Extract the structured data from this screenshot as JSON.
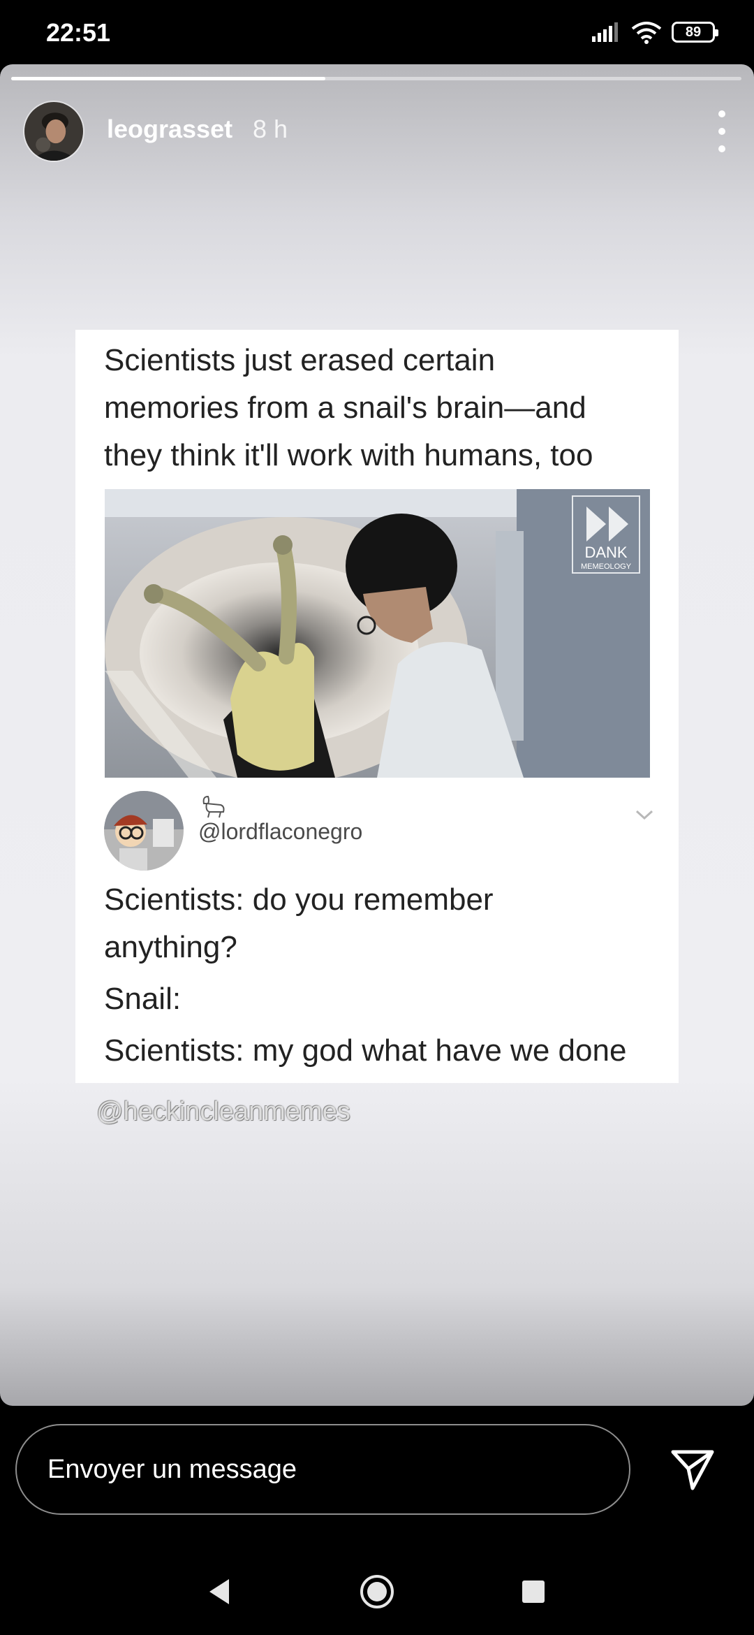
{
  "status_bar": {
    "time": "22:51",
    "battery": "89",
    "icons": [
      "signal-icon",
      "wifi-icon",
      "battery-icon"
    ]
  },
  "story": {
    "progress": 0.43,
    "user": {
      "username": "leograsset",
      "timestamp": "8 h",
      "avatar_icon": "avatar"
    },
    "meme": {
      "headline_lines": [
        "Scientists just erased certain",
        "memories from a snail's brain—and",
        "they think it'll work with humans, too"
      ],
      "photo_logo_lines": [
        "DANK",
        "MEMEOLOGY"
      ],
      "tweet": {
        "handle": "@lordflaconegro",
        "lines": [
          "Scientists: do you remember",
          "anything?",
          "Snail:",
          "Scientists: my god what have we done"
        ]
      }
    },
    "watermark": "@heckincleanmemes"
  },
  "reply": {
    "placeholder": "Envoyer un message"
  },
  "colors": {
    "background": "#000000",
    "text_light": "#ffffff",
    "meme_text": "#222222"
  }
}
